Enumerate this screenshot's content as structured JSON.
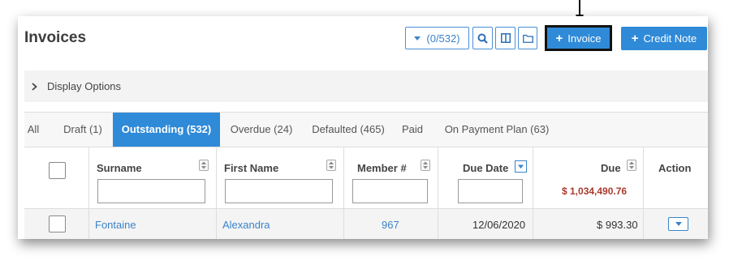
{
  "page": {
    "title": "Invoices"
  },
  "toolbar": {
    "filter_label": "(0/532)",
    "invoice_label": "Invoice",
    "credit_note_label": "Credit Note"
  },
  "display_options": {
    "label": "Display Options"
  },
  "tabs": [
    {
      "label": "All",
      "active": false
    },
    {
      "label": "Draft (1)",
      "active": false
    },
    {
      "label": "Outstanding (532)",
      "active": true
    },
    {
      "label": "Overdue (24)",
      "active": false
    },
    {
      "label": "Defaulted (465)",
      "active": false
    },
    {
      "label": "Paid",
      "active": false
    },
    {
      "label": "On Payment Plan (63)",
      "active": false
    }
  ],
  "table": {
    "headers": {
      "surname": "Surname",
      "first_name": "First Name",
      "member": "Member #",
      "due_date": "Due Date",
      "due": "Due",
      "action": "Action"
    },
    "due_total": "$ 1,034,490.76",
    "rows": [
      {
        "surname": "Fontaine",
        "first_name": "Alexandra",
        "member": "967",
        "due_date": "12/06/2020",
        "due": "$ 993.30"
      }
    ]
  },
  "colors": {
    "accent": "#2f8ad8",
    "total_red": "#a93a2e"
  },
  "icons": [
    "caret-down-icon",
    "search-icon",
    "columns-icon",
    "folder-icon",
    "plus-icon",
    "chevron-right-icon",
    "sort-icon",
    "down-arrow-icon"
  ]
}
